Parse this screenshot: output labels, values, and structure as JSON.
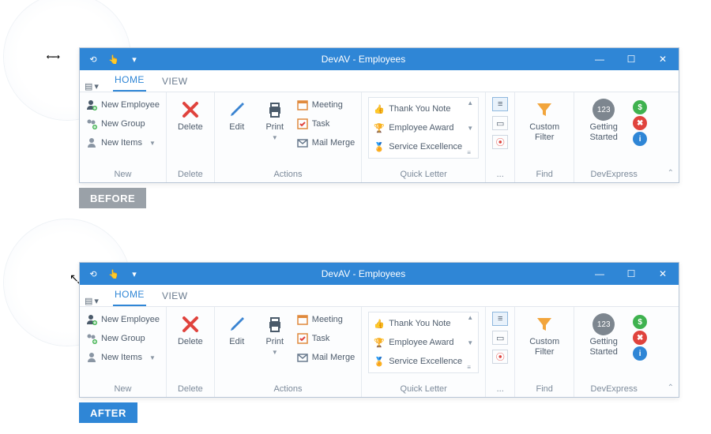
{
  "badges": {
    "before": "BEFORE",
    "after": "AFTER"
  },
  "window": {
    "title": "DevAV - Employees",
    "tabs": {
      "home": "HOME",
      "view": "VIEW"
    }
  },
  "ribbon": {
    "new": {
      "label": "New",
      "items": {
        "employee": "New Employee",
        "group": "New Group",
        "items": "New Items"
      }
    },
    "delete": {
      "label": "Delete",
      "btn": "Delete"
    },
    "actions": {
      "label": "Actions",
      "edit": "Edit",
      "print": "Print",
      "meeting": "Meeting",
      "task": "Task",
      "mailmerge": "Mail Merge"
    },
    "quick": {
      "label": "Quick Letter",
      "thank": "Thank You Note",
      "award": "Employee Award",
      "service": "Service Excellence"
    },
    "ellipsis": "...",
    "find": {
      "label": "Find",
      "custom": "Custom Filter"
    },
    "dev": {
      "label": "DevExpress",
      "getting": "Getting Started",
      "num": "123"
    }
  }
}
